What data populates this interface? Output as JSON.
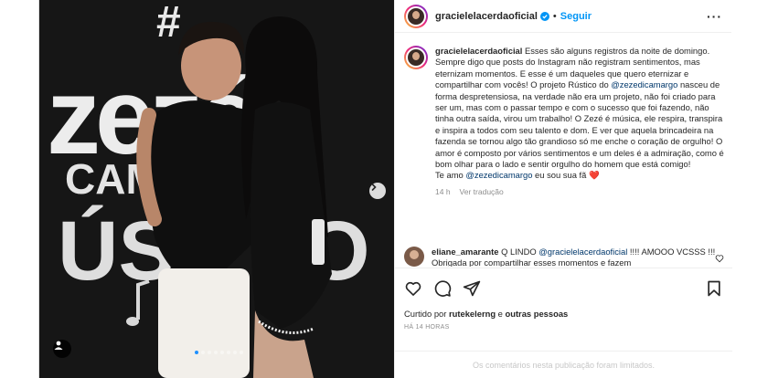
{
  "header": {
    "username": "gracielelacerdaoficial",
    "separator": "•",
    "follow_label": "Seguir",
    "more_icon": "more-horizontal-icon"
  },
  "photo": {
    "backdrop_letters": [
      "#",
      "zezé",
      "CAM",
      "ÚS",
      "O"
    ],
    "carousel_dots": 8,
    "active_dot": 0
  },
  "caption": {
    "username": "gracielelacerdaoficial",
    "part1": " Esses são alguns registros da noite de domingo. Sempre digo que posts do Instagram não registram sentimentos, mas eternizam momentos. E esse é um daqueles que quero eternizar e compartilhar com vocês! O projeto Rústico do ",
    "mention1": "@zezedicamargo",
    "part2": " nasceu de forma despretensiosa, na verdade não era um projeto, não foi criado para ser um, mas com o passar tempo e com o sucesso que foi fazendo, não tinha outra saída, virou um trabalho! O Zezé é música, ele respira, transpira e inspira a todos com seu talento e dom. E ver que aquela brincadeira na fazenda se tornou algo tão grandioso só me enche o coração de orgulho! O amor é composto por vários sentimentos e um deles é a admiração, como é bom olhar para o lado e sentir orgulho do homem que está comigo!",
    "part3": "Te amo ",
    "mention2": "@zezedicamargo",
    "part4": " eu sou sua fã ",
    "emoji": "❤️",
    "time": "14 h",
    "translate": "Ver tradução"
  },
  "comment": {
    "username": "eliane_amarante",
    "text": " Q LINDO ",
    "mention": "@gracielelacerdaoficial",
    "text2": " !!!! AMOOO VCSSS !!! Obrigada por compartilhar esses momentos e fazem"
  },
  "likes": {
    "prefix": "Curtido por ",
    "user": "rutekelerng",
    "middle": " e ",
    "others": "outras pessoas"
  },
  "time_ago": "HÁ 14 HORAS",
  "comments_limited": "Os comentários nesta publicação foram limitados.",
  "colors": {
    "link": "#0095f6",
    "mention": "#00376b",
    "heart": "#ed4956",
    "muted": "#8e8e8e"
  }
}
